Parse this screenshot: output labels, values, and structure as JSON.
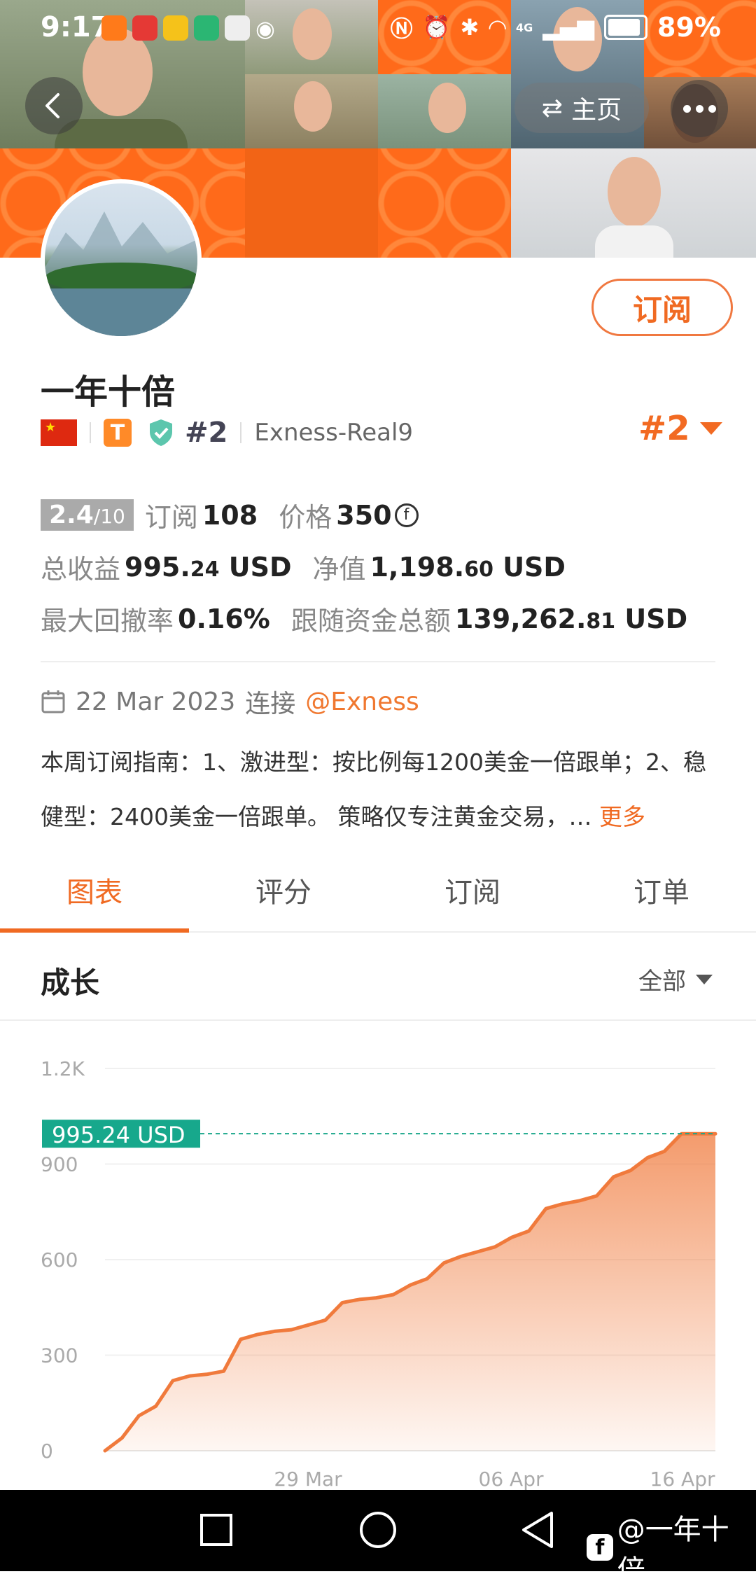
{
  "status_bar": {
    "time": "9:17",
    "battery": "89%",
    "signal": "4G"
  },
  "header": {
    "home_label": "主页"
  },
  "profile": {
    "name": "一年十倍",
    "subscribe_label": "订阅",
    "rank_badge": "#2",
    "server": "Exness-Real9",
    "rank_big": "#2",
    "tier_badge": "T"
  },
  "stats": {
    "score": "2.4",
    "score_max": "/10",
    "subscribe_label": "订阅",
    "subscribe_count": "108",
    "price_label": "价格",
    "price_value": "350",
    "coin_symbol": "f",
    "total_profit_label": "总收益",
    "total_profit_int": "995.",
    "total_profit_dec": "24",
    "total_profit_unit": "USD",
    "equity_label": "净值",
    "equity_int": "1,198.",
    "equity_dec": "60",
    "equity_unit": "USD",
    "drawdown_label": "最大回撤率",
    "drawdown_value": "0.16%",
    "follow_label": "跟随资金总额",
    "follow_int": "139,262.",
    "follow_dec": "81",
    "follow_unit": "USD"
  },
  "since": {
    "date": "22 Mar 2023",
    "connect_label": "连接",
    "broker": "@Exness"
  },
  "description": {
    "text": "本周订阅指南：1、激进型：按比例每1200美金一倍跟单；2、稳健型：2400美金一倍跟单。 策略仅专注黄金交易，…",
    "more_label": "更多"
  },
  "tabs": [
    {
      "label": "图表"
    },
    {
      "label": "评分"
    },
    {
      "label": "订阅"
    },
    {
      "label": "订单"
    }
  ],
  "growth": {
    "title": "成长",
    "range_label": "全部"
  },
  "chart_data": {
    "type": "area",
    "title": "",
    "y_ticks": [
      "0",
      "300",
      "600",
      "900",
      "1.2K"
    ],
    "x_ticks": [
      "29 Mar",
      "06 Apr",
      "16 Apr"
    ],
    "ylim": [
      0,
      1200
    ],
    "current_label": "995.24 USD",
    "current_value": 995.24,
    "grid": true,
    "color": "#f07a3c",
    "values": [
      0,
      40,
      110,
      140,
      220,
      235,
      240,
      250,
      350,
      365,
      375,
      380,
      395,
      410,
      465,
      475,
      480,
      490,
      520,
      540,
      590,
      610,
      625,
      640,
      670,
      690,
      760,
      775,
      785,
      800,
      860,
      880,
      920,
      940,
      995,
      995,
      995
    ]
  },
  "watermark": {
    "icon": "f",
    "text": "@一年十倍"
  }
}
